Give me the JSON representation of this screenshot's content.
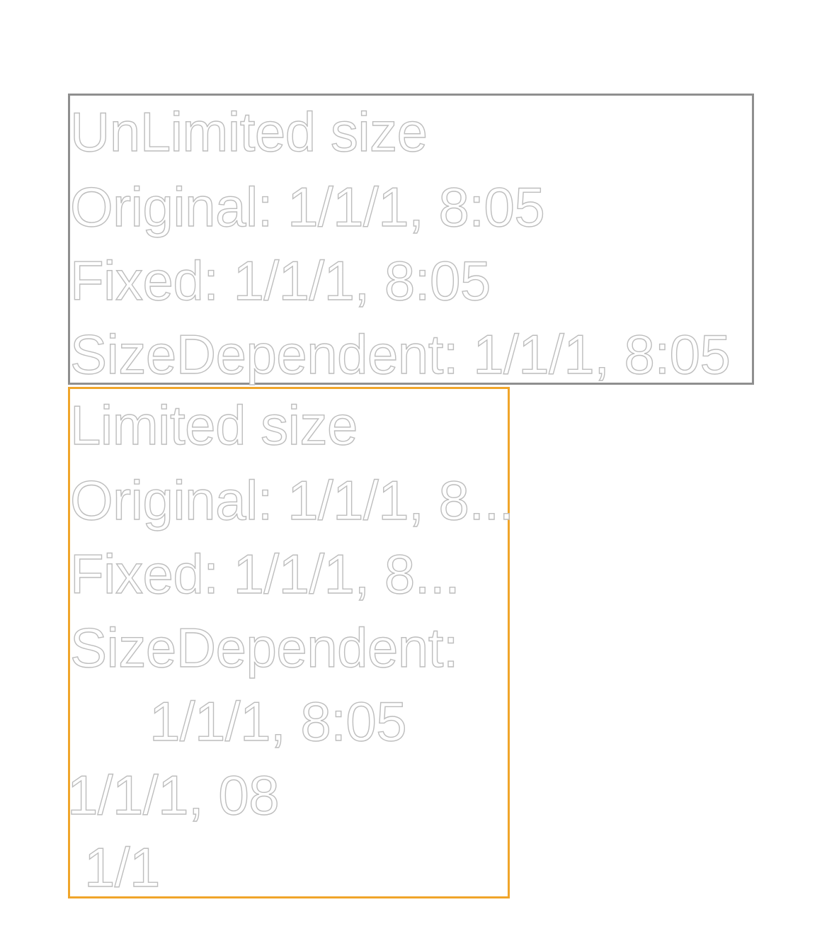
{
  "unlimited": {
    "heading": "UnLimited size",
    "original": "Original: 1/1/1, 8:05",
    "fixed": "Fixed: 1/1/1, 8:05",
    "size_dependent": "SizeDependent: 1/1/1, 8:05"
  },
  "limited": {
    "heading": "Limited size",
    "original": "Original: 1/1/1, 8...",
    "fixed": "Fixed: 1/1/1, 8...",
    "size_dependent_label": "SizeDependent:",
    "size_dependent_value": "1/1/1, 8:05",
    "short_1": "1/1/1, 08",
    "short_2": "1/1"
  },
  "colors": {
    "unlimited_border": "#8f8f8f",
    "limited_border": "#f0a52a",
    "text_outline": "#bdbdbd"
  }
}
